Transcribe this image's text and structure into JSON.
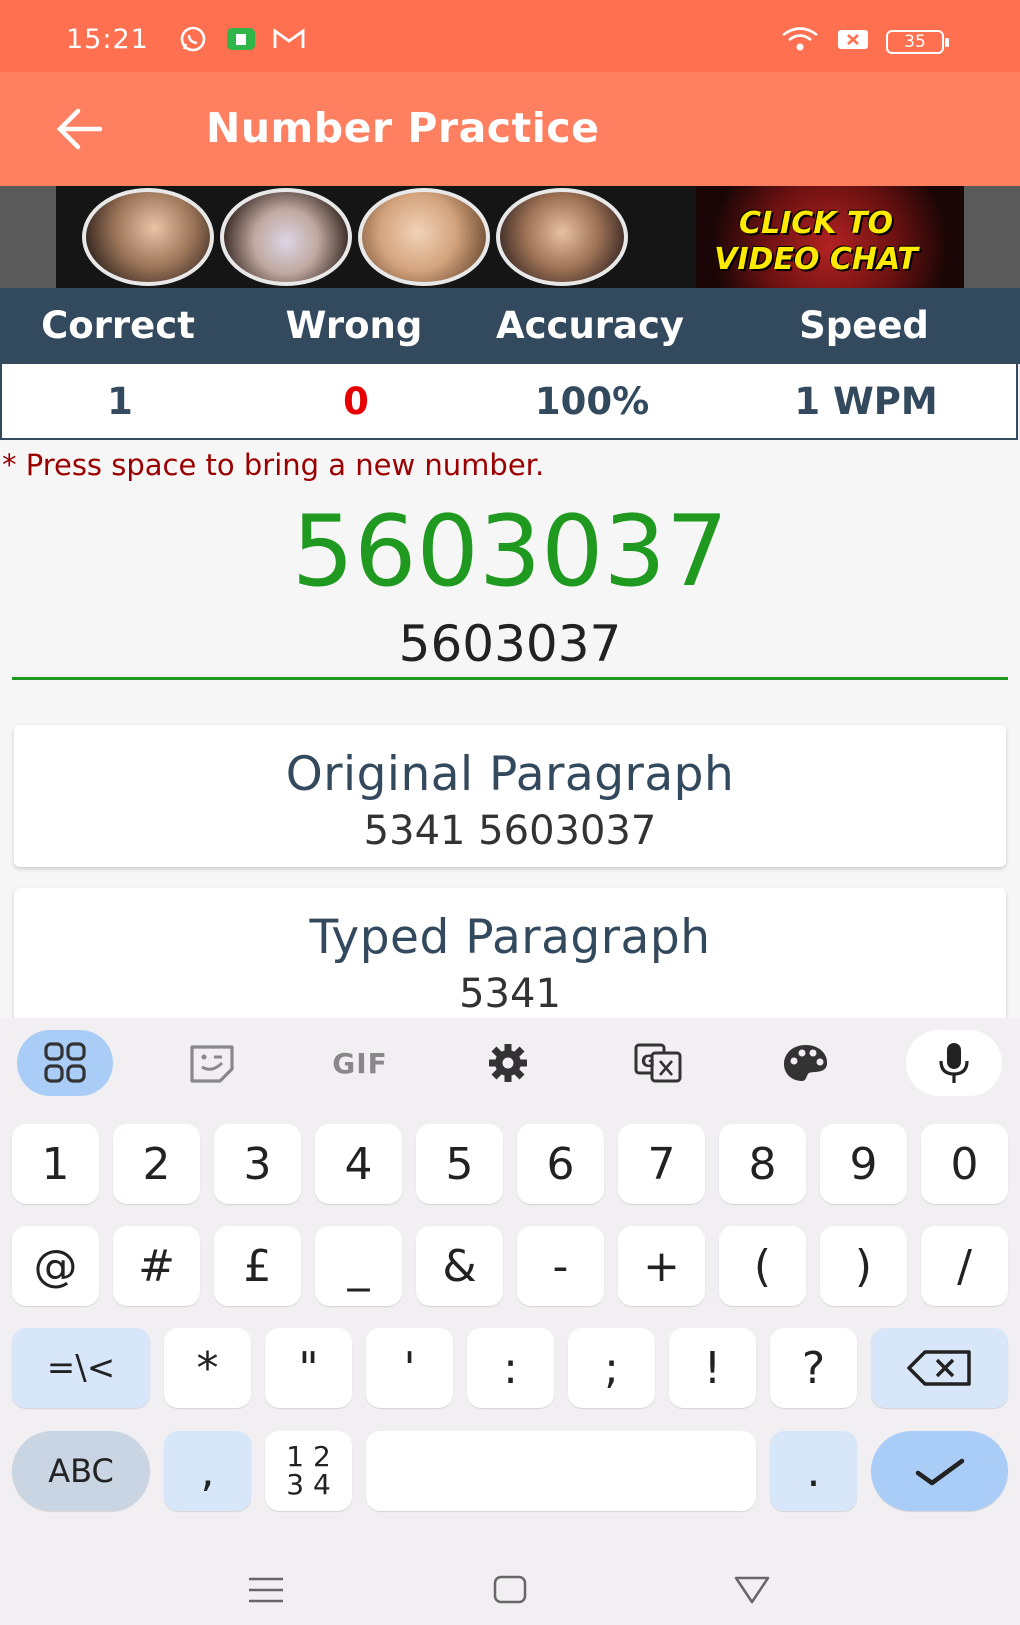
{
  "status_bar": {
    "time": "15:21",
    "battery": "35",
    "icons": [
      "whatsapp-icon",
      "notification-icon",
      "gmail-icon",
      "wifi-icon",
      "sim-icon",
      "battery-icon"
    ]
  },
  "app_bar": {
    "title": "Number Practice",
    "back_icon": "arrow-left-icon"
  },
  "ad": {
    "text_line1": "CLICK TO",
    "text_line2": "VIDEO CHAT"
  },
  "stats": {
    "headers": [
      "Correct",
      "Wrong",
      "Accuracy",
      "Speed"
    ],
    "values": [
      "1",
      "0",
      "100%",
      "1 WPM"
    ]
  },
  "practice": {
    "hint": "* Press space to bring a new number.",
    "target_number": "5603037",
    "typed_value": "5603037"
  },
  "original_card": {
    "title": "Original Paragraph",
    "text": "5341 5603037"
  },
  "typed_card": {
    "title": "Typed Paragraph",
    "text": "5341"
  },
  "keyboard": {
    "toolbar": [
      "apps-icon",
      "sticker-icon",
      "GIF",
      "settings-icon",
      "translate-icon",
      "palette-icon",
      "microphone-icon"
    ],
    "row1": [
      "1",
      "2",
      "3",
      "4",
      "5",
      "6",
      "7",
      "8",
      "9",
      "0"
    ],
    "row2": [
      "@",
      "#",
      "£",
      "_",
      "&",
      "-",
      "+",
      "(",
      ")",
      "/"
    ],
    "row3": [
      "=\\<",
      "*",
      "\"",
      "'",
      ":",
      ";",
      "!",
      "?"
    ],
    "abc": "ABC",
    "comma": ",",
    "numpad_top": "1 2",
    "numpad_bottom": "3 4",
    "period": "."
  },
  "colors": {
    "status_bar": "#ff7051",
    "app_bar": "#ff7f61",
    "stats_header": "#33495d",
    "correct_green": "#1f991f",
    "error_red": "#e60000",
    "keyboard_accent": "#a9cdf7"
  }
}
